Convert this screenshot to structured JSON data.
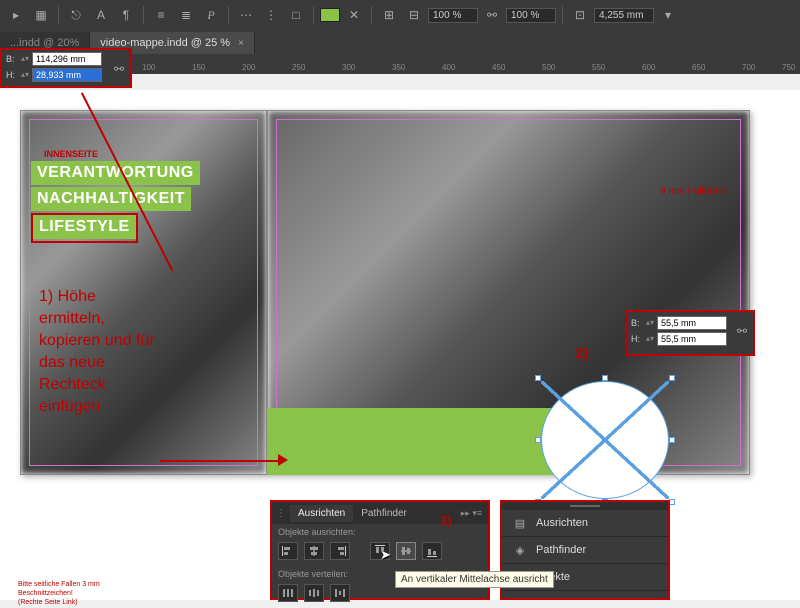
{
  "toolbar": {
    "zoom1": "100 %",
    "zoom2": "100 %",
    "coord": "4,255 mm"
  },
  "tabs": {
    "dim": "...indd @ 20%",
    "active": "video-mappe.indd @ 25 %"
  },
  "wh_panel": {
    "b_label": "B:",
    "h_label": "H:",
    "b_value": "114,296 mm",
    "h_value": "28,933 mm"
  },
  "ruler_ticks": [
    "100",
    "150",
    "200",
    "250",
    "300",
    "350",
    "400",
    "450",
    "500",
    "550",
    "600",
    "650",
    "700",
    "750"
  ],
  "page": {
    "inner_label": "INNENSEITE",
    "bar1": "VERANTWORTUNG",
    "bar2": "NACHHALTIGKEIT",
    "bar3": "LIFESTYLE"
  },
  "red_annotation": "1) Höhe ermitteln, kopieren und für das neue Rechteck einfügen",
  "anno_2": "2)",
  "anno_3": "3)",
  "fallhoehe": "9 mm Füllhöhe",
  "wh_box2": {
    "b_label": "B:",
    "h_label": "H:",
    "b_value": "55,5 mm",
    "h_value": "55,5 mm"
  },
  "align_panel": {
    "tab1": "Ausrichten",
    "tab2": "Pathfinder",
    "section1": "Objekte ausrichten:",
    "section2": "Objekte verteilen:"
  },
  "tooltip": "An vertikaler Mittelachse ausricht",
  "side_menu": {
    "item1": "Ausrichten",
    "item2": "Pathfinder",
    "item3": "Effekte"
  },
  "bottom_note": "Bitte seitliche Fallen 3 mm\nBeschnittzeichen!\n(Rechte Seite Link)"
}
